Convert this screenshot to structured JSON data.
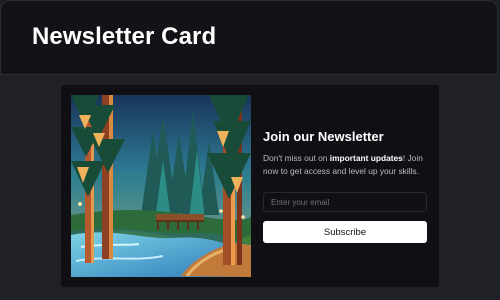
{
  "header": {
    "title": "Newsletter Card"
  },
  "card": {
    "image_icon": "forest-landscape-illustration",
    "title": "Join our Newsletter",
    "description": {
      "part1": "Don't miss out on ",
      "emphasis": "important updates",
      "part2": "! Join now to get access and level up your skills."
    },
    "email_input": {
      "value": "",
      "placeholder": "Enter your email"
    },
    "subscribe_label": "Subscribe"
  },
  "colors": {
    "page_background": "#1e1f24",
    "header_background": "#131317",
    "card_background": "#101014",
    "button_background": "#ffffff",
    "button_text": "#111113"
  }
}
